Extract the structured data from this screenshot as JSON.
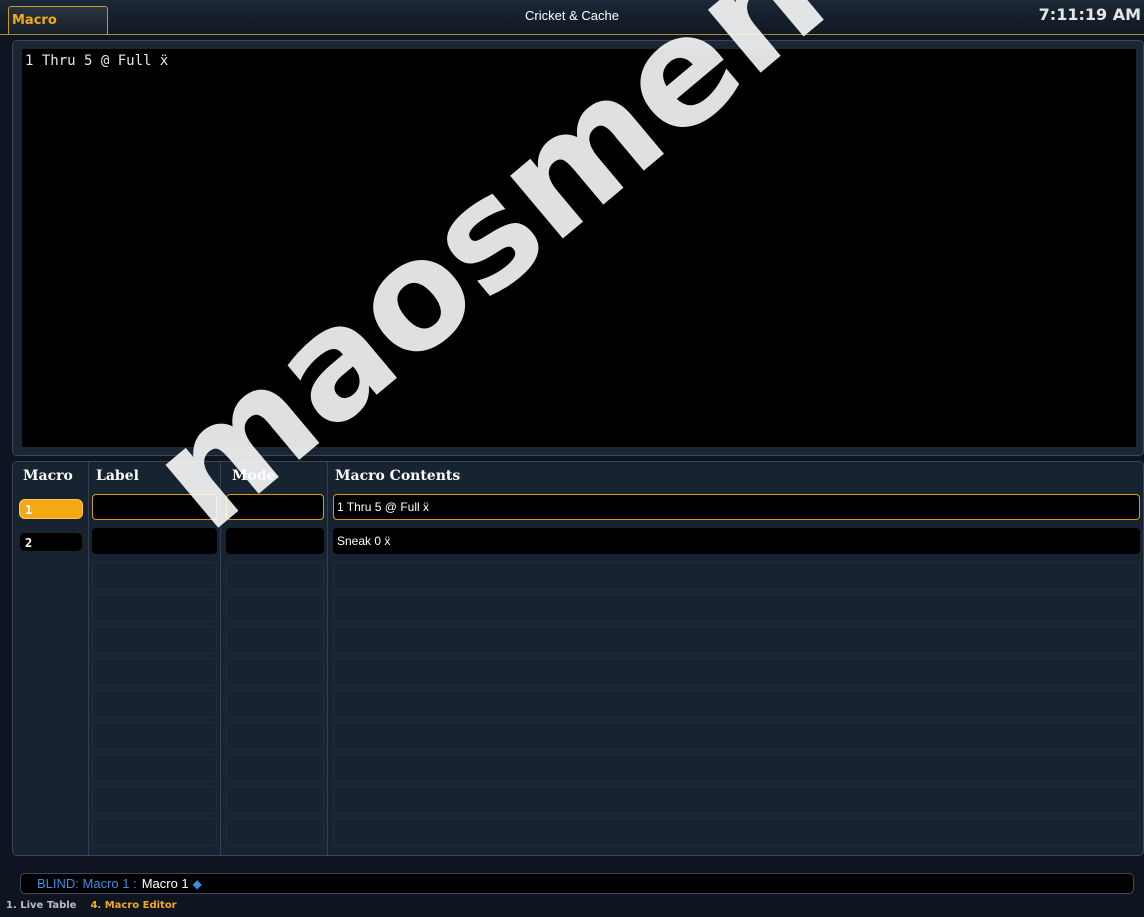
{
  "header": {
    "tab_label": "Macro Editor",
    "show_name": "Cricket & Cache",
    "clock": "7:11:19 AM"
  },
  "editor": {
    "content": "1 Thru 5 @ Full ẍ"
  },
  "table": {
    "columns": [
      "Macro",
      "Label",
      "Mode",
      "Macro Contents"
    ],
    "rows": [
      {
        "macro": "1",
        "label": "",
        "mode": "",
        "contents": "1 Thru 5 @ Full ẍ",
        "selected": true
      },
      {
        "macro": "2",
        "label": "",
        "mode": "",
        "contents": "Sneak 0 ẍ",
        "selected": false
      }
    ]
  },
  "command_line": {
    "mode": "BLIND: Macro  1 :",
    "text": "Macro 1",
    "icon": "blue-diamond-icon"
  },
  "bottom_tabs": [
    "1. Live Table",
    "4. Macro Editor"
  ],
  "watermark": "maosmendoza.com",
  "colors": {
    "accent": "#f2ab18",
    "command_blue": "#3b8de6",
    "background": "#0e1520"
  }
}
